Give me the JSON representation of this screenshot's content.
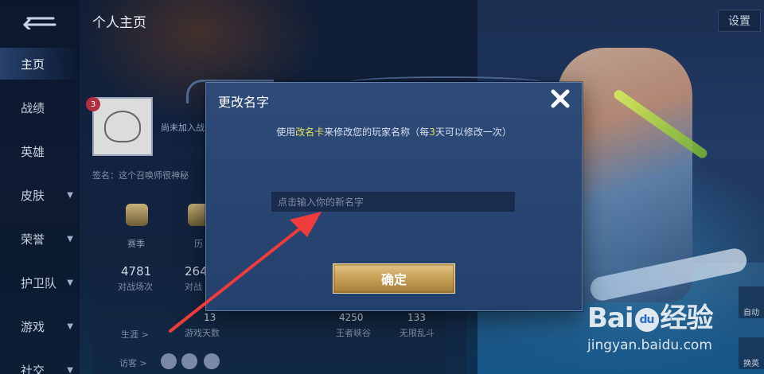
{
  "page": {
    "title": "个人主页",
    "settings_label": "设置"
  },
  "nav": {
    "items": [
      {
        "label": "主页",
        "active": true,
        "has_chevron": false
      },
      {
        "label": "战绩",
        "active": false,
        "has_chevron": false
      },
      {
        "label": "英雄",
        "active": false,
        "has_chevron": false
      },
      {
        "label": "皮肤",
        "active": false,
        "has_chevron": true
      },
      {
        "label": "荣誉",
        "active": false,
        "has_chevron": true
      },
      {
        "label": "护卫队",
        "active": false,
        "has_chevron": true
      },
      {
        "label": "游戏",
        "active": false,
        "has_chevron": true
      },
      {
        "label": "社交",
        "active": false,
        "has_chevron": true
      }
    ]
  },
  "profile": {
    "level_badge": "3",
    "guild_text": "尚未加入战",
    "signature": "签名：这个召唤师很神秘",
    "stats": [
      {
        "label": "赛季",
        "value": "4781",
        "sub": "对战场次"
      },
      {
        "label": "历",
        "value": "264",
        "sub": "对战"
      }
    ],
    "bottom_stats": [
      {
        "value": "13",
        "sub": "游戏天数"
      },
      {
        "value": "4250",
        "sub": "王者峡谷"
      },
      {
        "value": "133",
        "sub": "无限乱斗"
      }
    ],
    "visitors_label": "访客 >",
    "career_label": "生涯 >"
  },
  "side_tools": [
    "自动",
    "换英"
  ],
  "dialog": {
    "title": "更改名字",
    "desc_prefix": "使用",
    "desc_card": "改名卡",
    "desc_mid": "来修改您的玩家名称（每",
    "desc_days": "3",
    "desc_suffix": "天可以修改一次）",
    "input_placeholder": "点击输入你的新名字",
    "confirm_label": "确定",
    "close_icon": "close-icon"
  },
  "watermark": {
    "brand_left": "Bai",
    "brand_paw": "du",
    "brand_right": "经验",
    "url": "jingyan.baidu.com"
  },
  "colors": {
    "dialog_bg": "#2e4a78",
    "highlight": "#e8e25a",
    "confirm_gold": "#c79f55",
    "arrow_red": "#ef3b3b"
  }
}
